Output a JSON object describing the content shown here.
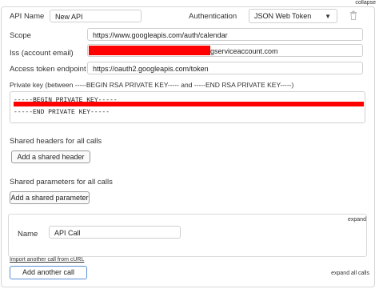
{
  "header": {
    "collapse_label": "collapse"
  },
  "api": {
    "name_label": "API Name",
    "name_value": "New API",
    "auth_label": "Authentication",
    "auth_value": "JSON Web Token",
    "scope_label": "Scope",
    "scope_value": "https://www.googleapis.com/auth/calendar",
    "iss_label": "Iss (account email)",
    "iss_value_suffix": "gserviceaccount.com",
    "token_label": "Access token endpoint",
    "token_value": "https://oauth2.googleapis.com/token",
    "key_label": "Private key (between -----BEGIN RSA PRIVATE KEY----- and -----END RSA PRIVATE KEY-----)",
    "key_begin": "-----BEGIN PRIVATE KEY-----",
    "key_end": "-----END PRIVATE KEY-----"
  },
  "shared": {
    "headers_label": "Shared headers for all calls",
    "add_header_button": "Add a shared header",
    "params_label": "Shared parameters for all calls",
    "add_param_button": "Add a shared parameter"
  },
  "call": {
    "expand_label": "expand",
    "name_label": "Name",
    "name_value": "API Call"
  },
  "footer": {
    "import_link": "Import another call from cURL",
    "add_call_button": "Add another call",
    "expand_all_label": "expand all calls"
  },
  "colors": {
    "redaction": "#ff0000",
    "primary_border": "#5a8fd8"
  }
}
